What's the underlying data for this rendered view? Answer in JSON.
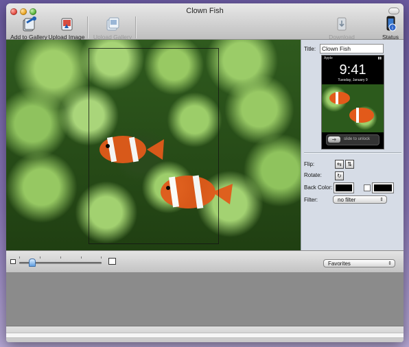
{
  "window": {
    "title": "Clown Fish"
  },
  "toolbar": {
    "add_to_gallery": "Add to Gallery",
    "upload_image": "Upload Image",
    "upload_gallery": "Upload Gallery",
    "download_photos": "Download Photos",
    "status": "Status"
  },
  "sidebar": {
    "title_label": "Title:",
    "title_value": "Clown Fish",
    "preview": {
      "carrier": "Apple",
      "time": "9:41",
      "date": "Tuesday, January 9",
      "unlock_text": "slide to unlock"
    },
    "flip_label": "Flip:",
    "rotate_label": "Rotate:",
    "back_color_label": "Back Color:",
    "back_color_value": "#000000",
    "second_color_value": "#000000",
    "filter_label": "Filter:",
    "filter_value": "no filter"
  },
  "zoom": {
    "level": 0.15
  },
  "bottom": {
    "favorites_label": "Favorites"
  },
  "colors": {
    "window_bg": "#cfcfcf",
    "sidebar_bg": "#d6dce6",
    "gallery_strip": "#8b8b8b",
    "accent_blue": "#5f9ee0"
  },
  "icons": {
    "add_to_gallery": "add-to-gallery-icon",
    "upload_image": "upload-image-icon",
    "upload_gallery": "upload-gallery-icon",
    "download_photos": "download-photos-icon",
    "status": "status-icon",
    "flip_horizontal": "flip-horizontal-icon",
    "flip_vertical": "flip-vertical-icon",
    "rotate": "rotate-icon",
    "zoom_small": "zoom-small-icon",
    "zoom_large": "zoom-large-icon"
  }
}
